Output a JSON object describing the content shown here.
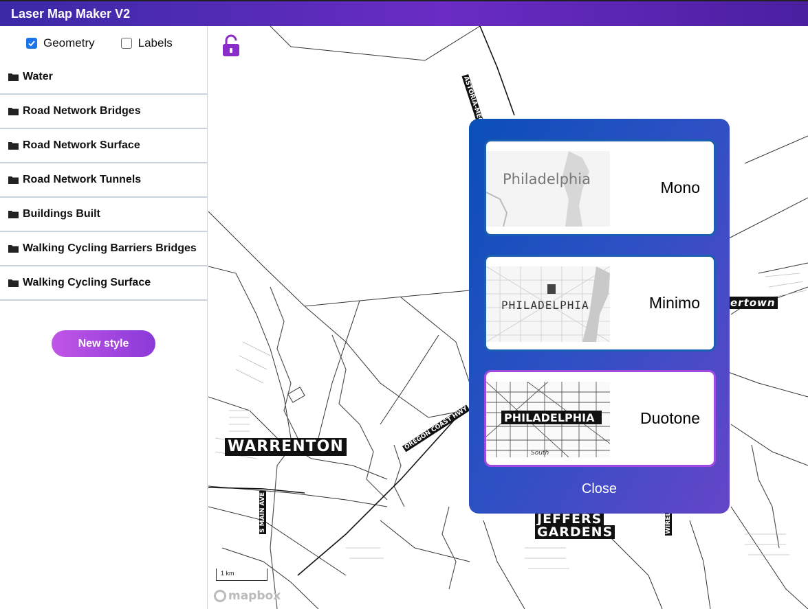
{
  "app": {
    "title": "Laser Map Maker V2"
  },
  "sidebar": {
    "toggles": [
      {
        "label": "Geometry",
        "checked": true
      },
      {
        "label": "Labels",
        "checked": false
      }
    ],
    "layers": [
      {
        "label": "Water"
      },
      {
        "label": "Road Network Bridges"
      },
      {
        "label": "Road Network Surface"
      },
      {
        "label": "Road Network Tunnels"
      },
      {
        "label": "Buildings Built"
      },
      {
        "label": "Walking Cycling Barriers Bridges"
      },
      {
        "label": "Walking Cycling Surface"
      }
    ],
    "new_style_label": "New style"
  },
  "map": {
    "lock_icon": "unlock-icon",
    "labels": {
      "warrenton": "WARRENTON",
      "jeffers_gardens_1": "JEFFERS",
      "jeffers_gardens_2": "GARDENS",
      "town_partial": "ertown",
      "astoria_bridge": "ASTORIA-MEGLER BRIDG",
      "oregon_coast": "OREGON COAST HWY",
      "s_main_ave": "S MAIN AVE",
      "wireless": "WIREL"
    },
    "scale_label": "1 km",
    "attribution": "mapbox"
  },
  "style_picker": {
    "options": [
      {
        "name": "Mono",
        "thumb_text": "Philadelphia",
        "selected": false
      },
      {
        "name": "Minimo",
        "thumb_text": "PHILADELPHIA",
        "selected": false
      },
      {
        "name": "Duotone",
        "thumb_text": "PHILADELPHIA",
        "thumb_sub": "South",
        "selected": true
      }
    ],
    "close_label": "Close"
  },
  "colors": {
    "header_gradient": [
      "#3a2aa6",
      "#6a2cc4"
    ],
    "accent_purple": "#8a3ad8",
    "modal_blue": "#0a4fb8",
    "checkbox_blue": "#1a73e8"
  }
}
